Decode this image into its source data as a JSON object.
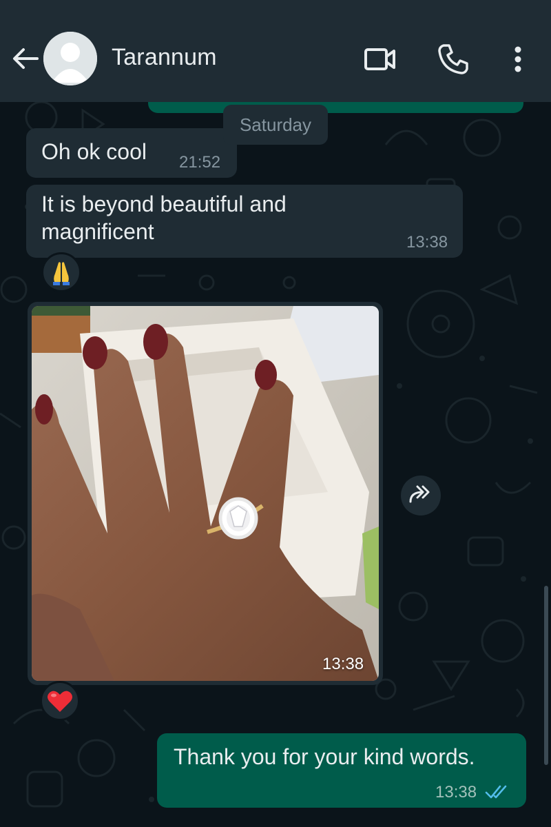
{
  "header": {
    "contact_name": "Tarannum",
    "icons": {
      "back": "arrow-left-icon",
      "avatar": "default-avatar-icon",
      "video": "video-camera-icon",
      "call": "phone-icon",
      "more": "more-vertical-icon"
    }
  },
  "chat": {
    "day_separator": "Saturday",
    "messages": [
      {
        "direction": "incoming",
        "text": "Oh ok cool",
        "time": "21:52"
      },
      {
        "direction": "incoming",
        "text_line1": "It is beyond beautiful and",
        "text_line2": "magnificent",
        "time": "13:38",
        "reaction": "🙏"
      },
      {
        "direction": "incoming",
        "type": "image",
        "image_desc": "photo-hand-with-oval-diamond-ring",
        "time": "13:38",
        "reaction": "❤️"
      },
      {
        "direction": "outgoing",
        "text": "Thank you for your kind words.",
        "time": "13:38",
        "status": "read-double-check-icon"
      }
    ]
  },
  "colors": {
    "header_bg": "#1f2c34",
    "chat_bg": "#0b141a",
    "incoming_bubble": "#1f2c34",
    "outgoing_bubble": "#005c4b",
    "read_ticks": "#53bdeb",
    "muted_text": "#8696a0"
  }
}
